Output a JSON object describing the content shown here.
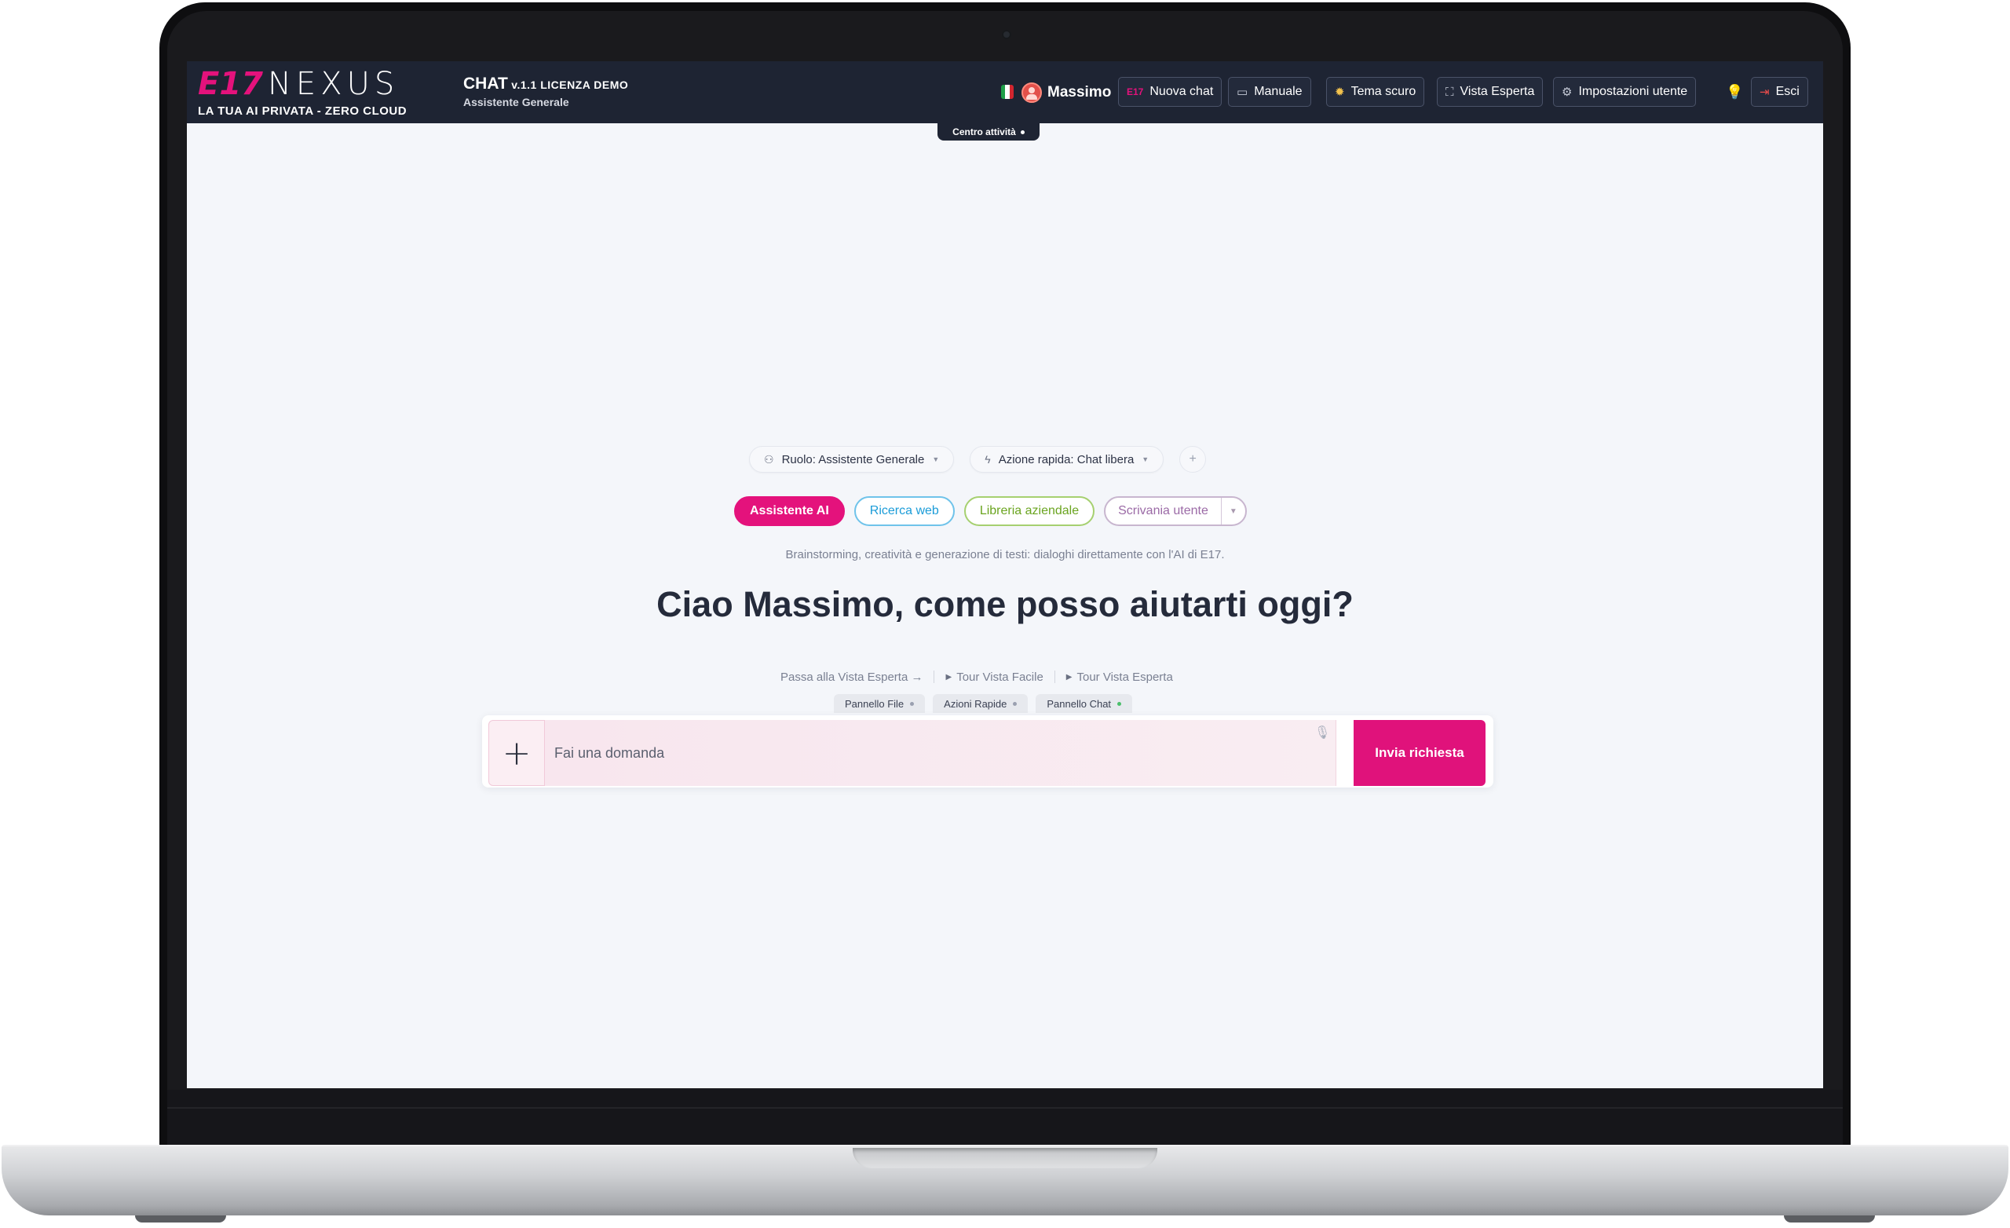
{
  "header": {
    "logo_brand": "E17",
    "logo_name": "NEXUS",
    "logo_tagline": "LA TUA AI PRIVATA - ZERO CLOUD",
    "app_title": "CHAT",
    "app_version": "v.1.1 LICENZA DEMO",
    "app_subtitle": "Assistente Generale",
    "user_name": "Massimo",
    "buttons": {
      "new_chat": "Nuova chat",
      "manual": "Manuale",
      "dark_theme": "Tema scuro",
      "expert_view": "Vista Esperta",
      "user_settings": "Impostazioni utente",
      "logout": "Esci"
    },
    "activity_center": "Centro attività"
  },
  "main": {
    "role_chip": "Ruolo: Assistente Generale",
    "quick_action_chip": "Azione rapida: Chat libera",
    "modes": {
      "ai_assistant": "Assistente AI",
      "web_search": "Ricerca web",
      "company_library": "Libreria aziendale",
      "user_desk": "Scrivania utente"
    },
    "mode_description": "Brainstorming, creatività e generazione di testi: dialoghi direttamente con l'AI di E17.",
    "greeting": "Ciao Massimo, come posso aiutarti oggi?",
    "links": {
      "switch_expert": "Passa alla Vista Esperta →",
      "tour_easy": "Tour Vista Facile",
      "tour_expert": "Tour Vista Esperta"
    },
    "panel_tabs": [
      "Pannello File",
      "Azioni Rapide",
      "Pannello Chat"
    ],
    "composer": {
      "placeholder": "Fai una domanda",
      "send_label": "Invia richiesta"
    }
  },
  "colors": {
    "accent": "#e4127c",
    "header_bg": "#1e2433",
    "web_mode": "#1b9cd8",
    "library_mode": "#6aa41f",
    "desk_mode": "#9b6aa6"
  },
  "icons": {
    "role": "person-icon",
    "quick_action": "lightning-icon",
    "manual": "book-icon",
    "theme": "sun-icon",
    "expert_view": "expand-icon",
    "settings": "gear-icon",
    "tips": "lightbulb-icon",
    "logout": "logout-icon",
    "voice": "microphone-icon"
  }
}
